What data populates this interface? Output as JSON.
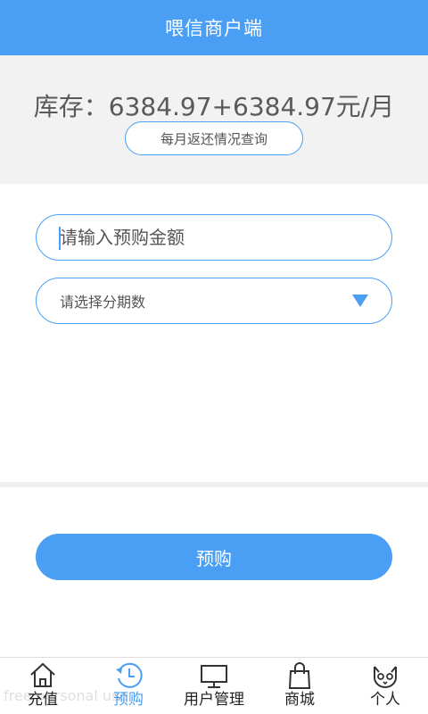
{
  "header": {
    "title": "喂信商户端"
  },
  "stock": {
    "text": "库存：6384.97+6384.97元/月",
    "query_label": "每月返还情况查询"
  },
  "form": {
    "amount_placeholder": "请输入预购金额",
    "period_label": "请选择分期数",
    "submit_label": "预购"
  },
  "tabbar": {
    "items": [
      {
        "label": "充值",
        "icon": "home-icon",
        "active": false
      },
      {
        "label": "预购",
        "icon": "clock-icon",
        "active": true
      },
      {
        "label": "用户管理",
        "icon": "monitor-icon",
        "active": false
      },
      {
        "label": "商城",
        "icon": "shopping-bag-icon",
        "active": false
      },
      {
        "label": "个人",
        "icon": "cat-face-icon",
        "active": false
      }
    ]
  },
  "watermark": {
    "text": "free personal use"
  },
  "colors": {
    "accent": "#4a9ff5",
    "panel": "#f2f2f2"
  }
}
